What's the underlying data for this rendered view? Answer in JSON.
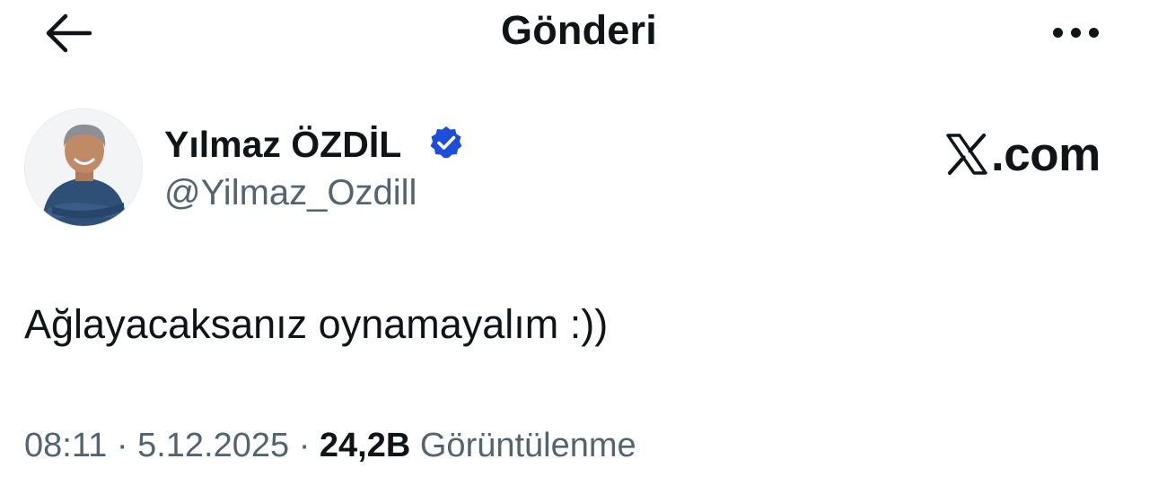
{
  "header": {
    "title": "Gönderi",
    "back_icon": "arrow-left-icon",
    "more_icon": "more-horizontal-icon"
  },
  "author": {
    "name": "Yılmaz ÖZDİL",
    "handle": "@Yilmaz_Ozdill",
    "verified": true,
    "verified_color": "#1d4ed8",
    "avatar_icon": "avatar-photo"
  },
  "watermark": {
    "text": ".com",
    "logo_icon": "x-logo-icon"
  },
  "tweet": {
    "text": "Ağlayacaksanız oynamayalım :))",
    "time": "08:11",
    "date": "5.12.2025",
    "separator": "·",
    "views_count": "24,2B",
    "views_label": "Görüntülenme"
  },
  "colors": {
    "text_primary": "#0f1419",
    "text_secondary": "#536471",
    "background": "#ffffff"
  }
}
